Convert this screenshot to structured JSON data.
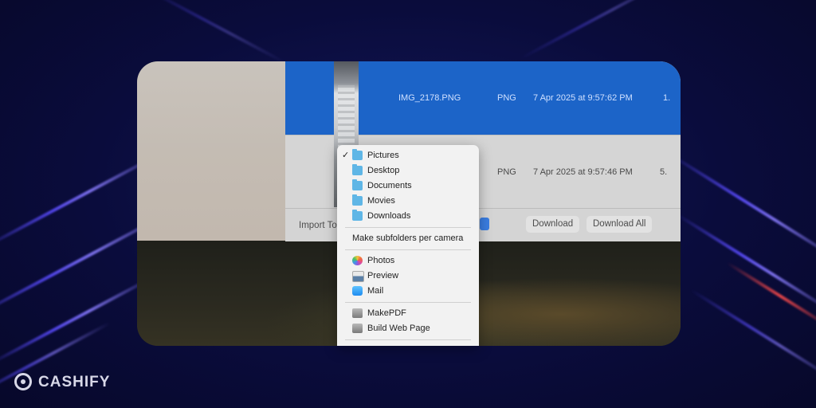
{
  "file_list": {
    "rows": [
      {
        "name": "IMG_2178.PNG",
        "kind": "PNG",
        "date": "7 Apr 2025 at 9:57:62 PM",
        "size": "1.",
        "selected": true
      },
      {
        "name": "",
        "kind": "PNG",
        "date": "7 Apr 2025 at 9:57:46 PM",
        "size": "5.",
        "selected": false
      }
    ]
  },
  "bottom_bar": {
    "import_to_label": "Import To",
    "download_label": "Download",
    "download_all_label": "Download All"
  },
  "import_menu": {
    "checked_item": "Pictures",
    "folders": [
      {
        "label": "Pictures",
        "icon": "folder-icon"
      },
      {
        "label": "Desktop",
        "icon": "folder-icon"
      },
      {
        "label": "Documents",
        "icon": "folder-icon"
      },
      {
        "label": "Movies",
        "icon": "folder-icon"
      },
      {
        "label": "Downloads",
        "icon": "downloads-folder-icon"
      }
    ],
    "option": "Make subfolders per camera",
    "apps": [
      {
        "label": "Photos",
        "icon": "photos-app-icon"
      },
      {
        "label": "Preview",
        "icon": "preview-app-icon"
      },
      {
        "label": "Mail",
        "icon": "mail-app-icon"
      }
    ],
    "automator": [
      {
        "label": "MakePDF",
        "icon": "automator-icon"
      },
      {
        "label": "Build Web Page",
        "icon": "automator-icon"
      }
    ]
  },
  "watermark": {
    "brand": "CASHIFY"
  },
  "colors": {
    "selection": "#1c64c8",
    "menu_bg": "#f2f2f2",
    "background": "#0b0d3a",
    "accent_streak": "#5a4cff"
  }
}
